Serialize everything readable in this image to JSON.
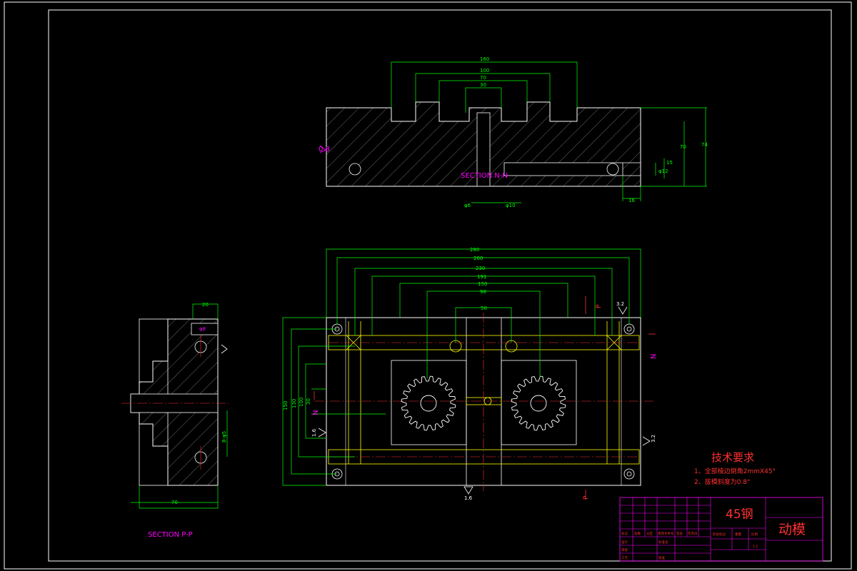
{
  "drawing": {
    "section_nn_label": "SECTION N-N",
    "section_pp_label": "SECTION P-P",
    "surface_marks": {
      "top": "0.8",
      "left": "1.6",
      "right": "3.2",
      "bottom": "1.6"
    },
    "top_dims": {
      "d1": "160",
      "d2": "100",
      "d3": "70",
      "d4": "30",
      "phi6": "φ6",
      "phi10": "φ10",
      "phi12": "φ12",
      "v15": "15",
      "v16": "16",
      "v70": "70",
      "v74": "74"
    },
    "front_dims": {
      "w280": "280",
      "w260": "260",
      "w230": "230",
      "w191": "191",
      "w150": "150",
      "w98": "98",
      "w50": "50",
      "h150": "150",
      "h130": "130",
      "h100": "100",
      "h30": "30"
    },
    "side_dims": {
      "w20": "20",
      "w70": "70",
      "hole": "8-φ5",
      "phi": "φ8"
    },
    "cut_labels": {
      "p_top": "P",
      "p_bottom": "P",
      "n_left": "N",
      "n_right": "N",
      "ra32": "3.2",
      "ra16": "1.6"
    }
  },
  "requirements": {
    "title": "技术要求",
    "items": [
      "1、全部棱边倒角2mmX45°",
      "2、拔模斜度为0.8°"
    ]
  },
  "title_block": {
    "material": "45钢",
    "part_name": "动模",
    "scale": "1:1",
    "row_labels": [
      "标记",
      "处数",
      "分区",
      "更改文件号",
      "签名",
      "年月日"
    ],
    "role_labels": [
      "设计",
      "标准化",
      "审核",
      "工艺",
      "批准"
    ],
    "field_labels": [
      "阶段标记",
      "重量",
      "比例"
    ]
  }
}
